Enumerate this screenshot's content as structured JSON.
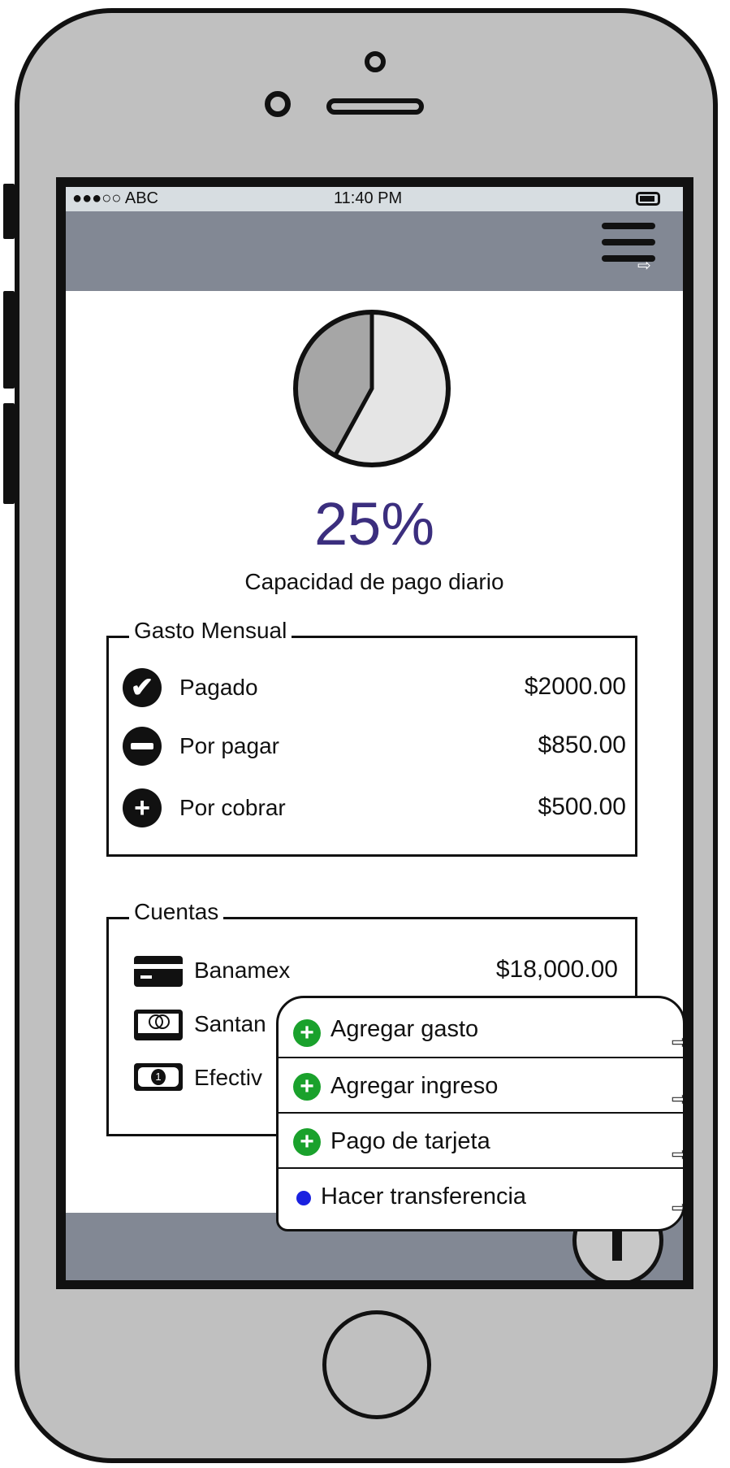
{
  "status_bar": {
    "carrier": "●●●○○ ABC",
    "time": "11:40 PM"
  },
  "header": {
    "menu_icon": "hamburger-menu-icon"
  },
  "summary": {
    "percentage": "25%",
    "caption": "Capacidad de pago diario",
    "pie_slices": [
      {
        "fraction": 0.42,
        "color": "#a6a6a6"
      },
      {
        "fraction": 0.58,
        "color": "#e5e5e5"
      }
    ]
  },
  "gasto_mensual": {
    "title": "Gasto Mensual",
    "rows": [
      {
        "icon": "check-circle-icon",
        "label": "Pagado",
        "amount": "$2000.00"
      },
      {
        "icon": "minus-circle-icon",
        "label": "Por pagar",
        "amount": "$850.00"
      },
      {
        "icon": "plus-circle-icon",
        "label": "Por cobrar",
        "amount": "$500.00"
      }
    ]
  },
  "cuentas": {
    "title": "Cuentas",
    "rows": [
      {
        "icon": "credit-card-icon",
        "label": "Banamex",
        "amount": "$18,000.00"
      },
      {
        "icon": "mastercard-icon",
        "label": "Santan"
      },
      {
        "icon": "cash-icon",
        "label": "Efectiv"
      }
    ]
  },
  "action_menu": {
    "items": [
      {
        "icon": "green-plus-icon",
        "label": "Agregar gasto"
      },
      {
        "icon": "green-plus-icon",
        "label": "Agregar ingreso"
      },
      {
        "icon": "green-plus-icon",
        "label": "Pago de tarjeta"
      },
      {
        "icon": "blue-dot-icon",
        "label": "Hacer transferencia"
      }
    ]
  },
  "fab": {
    "icon": "plus-icon"
  },
  "colors": {
    "accent_text": "#3b2e7e",
    "bar_gray": "#828894",
    "status_bar": "#d7dde1",
    "phone_body": "#c0c0c0",
    "green": "#1aa12c",
    "blue": "#1a21e0"
  }
}
